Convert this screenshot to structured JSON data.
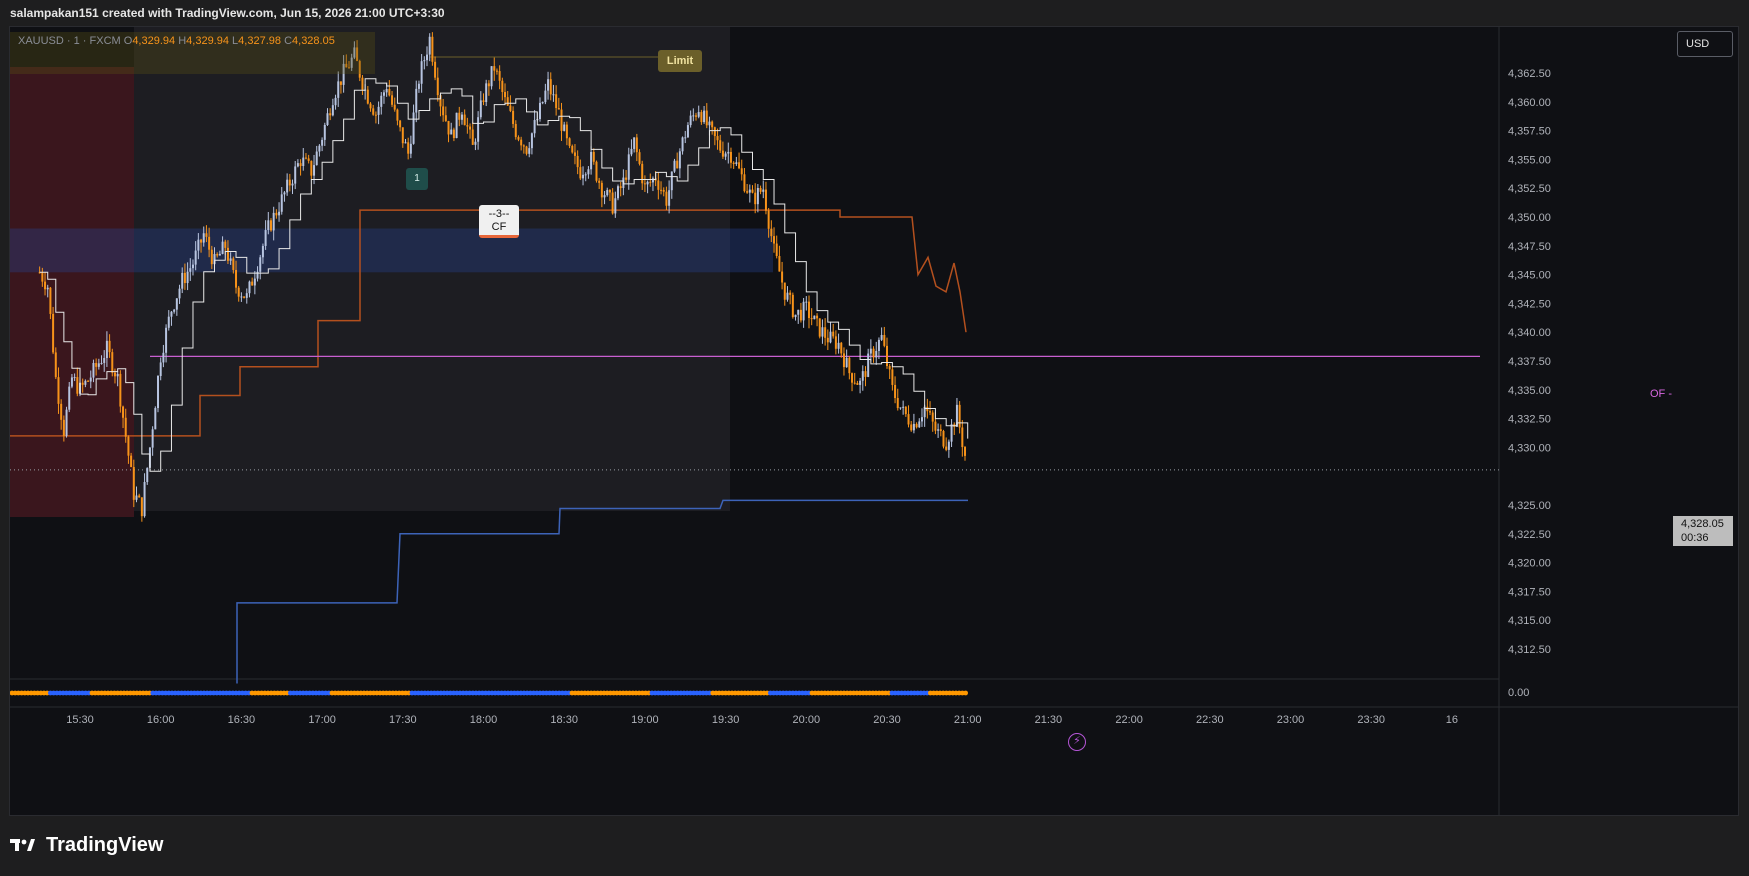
{
  "header": {
    "attribution": "salampakan151 created with TradingView.com, Jun 15, 2026 21:00 UTC+3:30"
  },
  "legend": {
    "symbol": "XAUUSD · 1 · FXCM",
    "open_label": "O",
    "open": "4,329.94",
    "high_label": "H",
    "high": "4,329.94",
    "low_label": "L",
    "low": "4,327.98",
    "close_label": "C",
    "close": "4,328.05"
  },
  "currency_button": "USD",
  "annotations": {
    "limit": "Limit",
    "badge": "1",
    "cf_top": "--3--",
    "cf_bottom": "CF",
    "of": "OF -",
    "flash_icon": "lightning-icon"
  },
  "last_price": {
    "price": "4,328.05",
    "countdown": "00:36"
  },
  "oscillator_value": "0.00",
  "footer": {
    "brand": "TradingView"
  },
  "colors": {
    "up": "#b7c4e0",
    "down": "#f7931a",
    "of_line": "#c85fd0",
    "upper_band": "#b4501e",
    "lower_band": "#3d63b8",
    "osc_blue": "#2962ff",
    "osc_orange": "#ff9800"
  },
  "chart_data": {
    "type": "candlestick",
    "x_tick_labels": [
      "15:30",
      "16:00",
      "16:30",
      "17:00",
      "17:30",
      "18:00",
      "18:30",
      "19:00",
      "19:30",
      "20:00",
      "20:30",
      "21:00",
      "21:30",
      "22:00",
      "22:30",
      "23:00",
      "23:30",
      "16"
    ],
    "y_tick_labels": [
      "4,362.50",
      "4,360.00",
      "4,357.50",
      "4,355.00",
      "4,352.50",
      "4,350.00",
      "4,347.50",
      "4,345.00",
      "4,342.50",
      "4,340.00",
      "4,337.50",
      "4,335.00",
      "4,332.50",
      "4,330.00",
      "4,325.00",
      "4,322.50",
      "4,320.00",
      "4,317.50",
      "4,315.00",
      "4,312.50"
    ],
    "y_range": [
      4310.0,
      4365.0
    ],
    "price_path": [
      [
        "15:15",
        4345.2
      ],
      [
        "15:18",
        4344.0
      ],
      [
        "15:21",
        4336.0
      ],
      [
        "15:24",
        4331.5
      ],
      [
        "15:27",
        4336.0
      ],
      [
        "15:30",
        4335.0
      ],
      [
        "15:33",
        4335.8
      ],
      [
        "15:36",
        4337.0
      ],
      [
        "15:40",
        4338.5
      ],
      [
        "15:44",
        4336.0
      ],
      [
        "15:47",
        4331.0
      ],
      [
        "15:50",
        4326.0
      ],
      [
        "15:53",
        4324.7
      ],
      [
        "15:56",
        4330.0
      ],
      [
        "16:00",
        4338.0
      ],
      [
        "16:04",
        4342.0
      ],
      [
        "16:08",
        4344.5
      ],
      [
        "16:12",
        4346.0
      ],
      [
        "16:16",
        4348.5
      ],
      [
        "16:20",
        4346.0
      ],
      [
        "16:24",
        4347.5
      ],
      [
        "16:28",
        4344.0
      ],
      [
        "16:32",
        4343.0
      ],
      [
        "16:36",
        4346.0
      ],
      [
        "16:40",
        4349.0
      ],
      [
        "16:44",
        4351.0
      ],
      [
        "16:48",
        4353.0
      ],
      [
        "16:52",
        4355.0
      ],
      [
        "16:56",
        4354.0
      ],
      [
        "17:00",
        4357.0
      ],
      [
        "17:04",
        4360.5
      ],
      [
        "17:08",
        4362.5
      ],
      [
        "17:12",
        4364.0
      ],
      [
        "17:16",
        4361.0
      ],
      [
        "17:20",
        4359.0
      ],
      [
        "17:24",
        4361.5
      ],
      [
        "17:28",
        4358.0
      ],
      [
        "17:32",
        4355.5
      ],
      [
        "17:36",
        4362.0
      ],
      [
        "17:40",
        4365.5
      ],
      [
        "17:44",
        4360.0
      ],
      [
        "17:48",
        4357.0
      ],
      [
        "17:52",
        4359.5
      ],
      [
        "17:56",
        4356.0
      ],
      [
        "18:00",
        4360.5
      ],
      [
        "18:04",
        4363.0
      ],
      [
        "18:08",
        4360.0
      ],
      [
        "18:12",
        4357.5
      ],
      [
        "18:16",
        4356.0
      ],
      [
        "18:20",
        4358.5
      ],
      [
        "18:24",
        4361.5
      ],
      [
        "18:28",
        4359.0
      ],
      [
        "18:32",
        4355.5
      ],
      [
        "18:36",
        4354.0
      ],
      [
        "18:40",
        4355.0
      ],
      [
        "18:44",
        4352.5
      ],
      [
        "18:48",
        4351.0
      ],
      [
        "18:52",
        4353.0
      ],
      [
        "18:56",
        4356.5
      ],
      [
        "19:00",
        4352.5
      ],
      [
        "19:04",
        4353.5
      ],
      [
        "19:08",
        4351.5
      ],
      [
        "19:12",
        4355.0
      ],
      [
        "19:16",
        4358.0
      ],
      [
        "19:20",
        4359.5
      ],
      [
        "19:24",
        4357.5
      ],
      [
        "19:28",
        4356.0
      ],
      [
        "19:32",
        4355.5
      ],
      [
        "19:36",
        4353.5
      ],
      [
        "19:40",
        4351.5
      ],
      [
        "19:44",
        4352.5
      ],
      [
        "19:48",
        4347.0
      ],
      [
        "19:52",
        4343.5
      ],
      [
        "19:56",
        4341.5
      ],
      [
        "20:00",
        4342.0
      ],
      [
        "20:04",
        4340.5
      ],
      [
        "20:08",
        4339.5
      ],
      [
        "20:12",
        4339.0
      ],
      [
        "20:16",
        4336.5
      ],
      [
        "20:20",
        4335.5
      ],
      [
        "20:24",
        4338.0
      ],
      [
        "20:28",
        4339.5
      ],
      [
        "20:32",
        4335.0
      ],
      [
        "20:36",
        4333.0
      ],
      [
        "20:40",
        4332.0
      ],
      [
        "20:44",
        4333.5
      ],
      [
        "20:48",
        4331.5
      ],
      [
        "20:52",
        4330.5
      ],
      [
        "20:56",
        4333.0
      ],
      [
        "21:00",
        4328.05
      ]
    ],
    "indicator_levels": {
      "of_level": 4337.9,
      "upper_band_end": 4340.0,
      "lower_band_end": 4325.0
    }
  }
}
